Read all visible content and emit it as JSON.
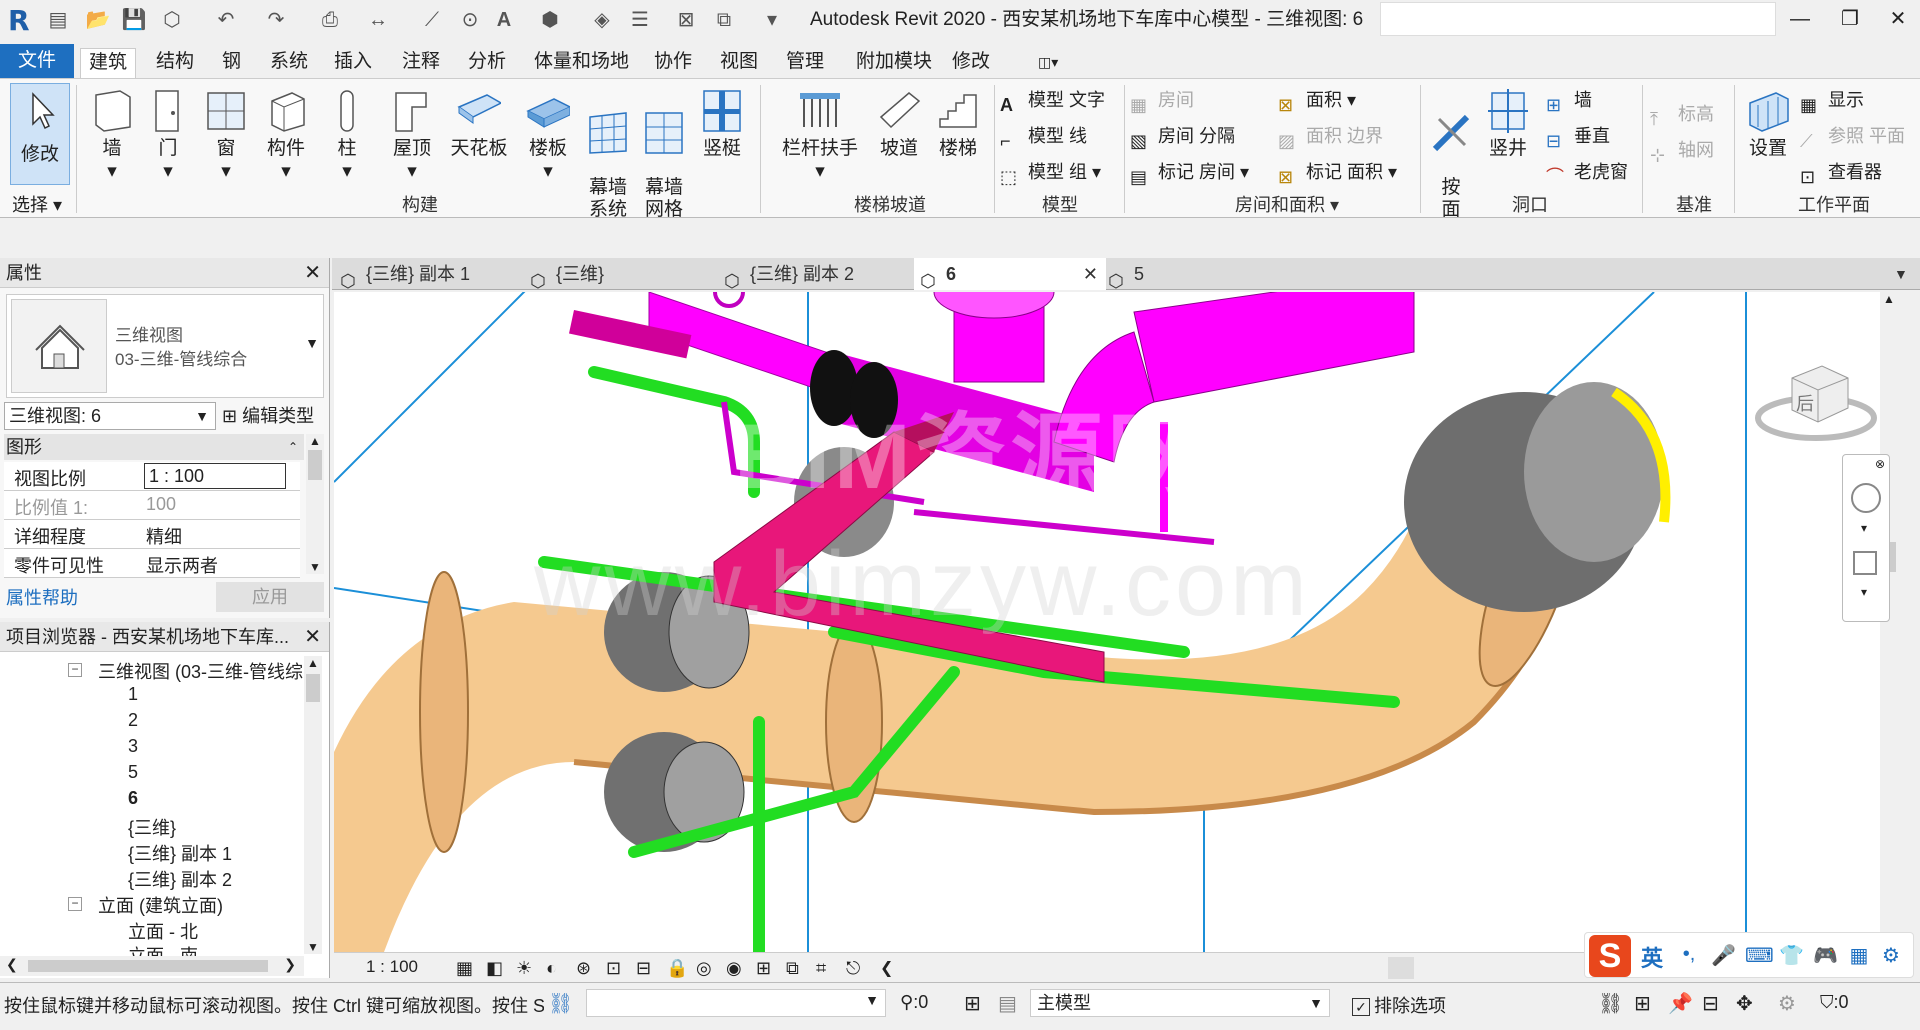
{
  "title": "Autodesk Revit 2020 - 西安某机场地下车库中心模型 - 三维视图: 6",
  "ribbon_tabs": [
    "文件",
    "建筑",
    "结构",
    "钢",
    "系统",
    "插入",
    "注释",
    "分析",
    "体量和场地",
    "协作",
    "视图",
    "管理",
    "附加模块",
    "修改"
  ],
  "active_tab": "建筑",
  "ribbon": {
    "modify": "修改",
    "select": "选择",
    "build": {
      "wall": "墙",
      "door": "门",
      "window": "窗",
      "component": "构件",
      "column": "柱",
      "roof": "屋顶",
      "ceiling": "天花板",
      "floor": "楼板",
      "curtain_system": "幕墙\n系统",
      "curtain_grid": "幕墙\n网格",
      "mullion": "竖梃",
      "label": "构建"
    },
    "stairs": {
      "railing": "栏杆扶手",
      "ramp": "坡道",
      "stair": "楼梯",
      "label": "楼梯坡道"
    },
    "model": {
      "text": "模型 文字",
      "line": "模型 线",
      "group": "模型 组",
      "label": "模型"
    },
    "room": {
      "room": "房间",
      "separator": "房间 分隔",
      "tag_room": "标记 房间",
      "area": "面积",
      "area_boundary": "面积 边界",
      "tag_area": "标记 面积",
      "label": "房间和面积"
    },
    "opening": {
      "by_face": "按\n面",
      "shaft": "竖井",
      "wall": "墙",
      "vertical": "垂直",
      "dormer": "老虎窗",
      "label": "洞口"
    },
    "datum": {
      "level": "标高",
      "grid": "轴网",
      "label": "基准"
    },
    "workplane": {
      "set": "设置",
      "show": "显示",
      "ref_plane": "参照 平面",
      "viewer": "查看器",
      "label": "工作平面"
    }
  },
  "properties": {
    "header": "属性",
    "type_line1": "三维视图",
    "type_line2": "03-三维-管线综合",
    "view_select": "三维视图: 6",
    "edit_type": "编辑类型",
    "category": "图形",
    "rows": [
      {
        "key": "视图比例",
        "value": "1 : 100"
      },
      {
        "key": "比例值 1:",
        "value": "100"
      },
      {
        "key": "详细程度",
        "value": "精细"
      },
      {
        "key": "零件可见性",
        "value": "显示两者"
      }
    ],
    "help": "属性帮助",
    "apply": "应用"
  },
  "browser": {
    "header": "项目浏览器 - 西安某机场地下车库...",
    "node_3d": "三维视图 (03-三维-管线综",
    "views": [
      "1",
      "2",
      "3",
      "5",
      "6",
      "{三维}",
      "{三维} 副本 1",
      "{三维} 副本 2"
    ],
    "active_view": "6",
    "node_elev": "立面 (建筑立面)",
    "elev_items": [
      "立面 - 北",
      "立面 - 南"
    ]
  },
  "view_tabs": [
    "{三维} 副本 1",
    "{三维}",
    "{三维} 副本 2",
    "6",
    "5"
  ],
  "active_view_tab": "6",
  "viewport": {
    "watermark1": "BIM资源网",
    "watermark2": "www.bimzyw.com",
    "cube_face": "后"
  },
  "viewbar": {
    "scale": "1 : 100"
  },
  "status": {
    "hint": "按住鼠标键并移动鼠标可滚动视图。按住 Ctrl 键可缩放视图。按住 S",
    "work_count": ":0",
    "model": "主模型",
    "exclude": "排除选项",
    "filter_count": ":0"
  },
  "ime": {
    "lang": "英"
  },
  "colors": {
    "accent": "#1e6fc0",
    "magenta": "#ff00ff",
    "pink": "#e8177a",
    "pipe": "#f5c98f",
    "green": "#22dd22",
    "gray": "#808080",
    "blue_line": "#1b8fd8"
  }
}
